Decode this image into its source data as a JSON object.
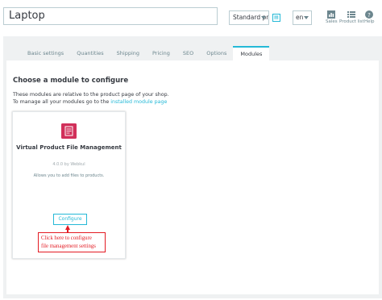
{
  "header": {
    "product_name": "Laptop",
    "product_type": "Standard pr",
    "language": "en",
    "links": [
      {
        "label": "Sales",
        "icon": "chart-icon"
      },
      {
        "label": "Product list",
        "icon": "list-icon"
      },
      {
        "label": "Help",
        "icon": "help-icon"
      }
    ]
  },
  "tabs": [
    {
      "label": "Basic settings",
      "active": false
    },
    {
      "label": "Quantities",
      "active": false
    },
    {
      "label": "Shipping",
      "active": false
    },
    {
      "label": "Pricing",
      "active": false
    },
    {
      "label": "SEO",
      "active": false
    },
    {
      "label": "Options",
      "active": false
    },
    {
      "label": "Modules",
      "active": true
    }
  ],
  "modules": {
    "title": "Choose a module to configure",
    "desc_line1": "These modules are relative to the product page of your shop.",
    "desc_line2_prefix": "To manage all your modules go to the ",
    "desc_line2_link": "installed module page",
    "card": {
      "name": "Virtual Product File Management",
      "version": "4.0.0 by Webkul",
      "description": "Allows you to add files to products.",
      "configure_label": "Configure",
      "icon": "module-icon"
    },
    "callout": {
      "line1": "Click here to configure",
      "line2": "file management settings"
    }
  },
  "colors": {
    "accent": "#25b9d7",
    "callout": "#e31b23",
    "module_icon": "#d1305a"
  }
}
